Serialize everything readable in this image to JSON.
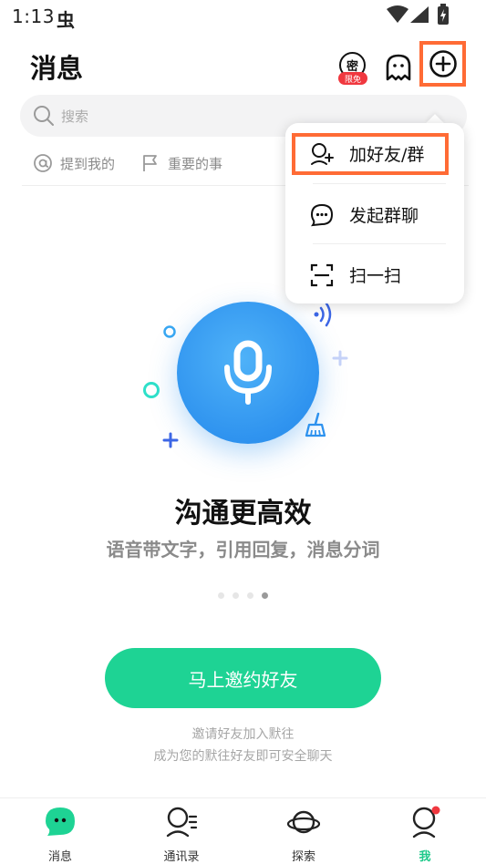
{
  "status_bar": {
    "time": "1:13",
    "app_icon": "虫"
  },
  "header": {
    "title": "消息",
    "secret_icon_text": "密",
    "secret_badge": "限免"
  },
  "search": {
    "placeholder": "搜索"
  },
  "filters": {
    "mention": "提到我的",
    "important": "重要的事"
  },
  "dropdown": {
    "items": [
      {
        "label": "加好友/群",
        "icon": "add-person-icon"
      },
      {
        "label": "发起群聊",
        "icon": "chat-bubble-icon"
      },
      {
        "label": "扫一扫",
        "icon": "scan-icon"
      }
    ]
  },
  "empty_state": {
    "title": "沟通更高效",
    "subtitle": "语音带文字，引用回复，消息分词",
    "page_count": 4,
    "active_page": 4
  },
  "invite": {
    "button_label": "马上邀约好友",
    "note_line1": "邀请好友加入默往",
    "note_line2": "成为您的默往好友即可安全聊天"
  },
  "bottom_nav": {
    "items": [
      {
        "label": "消息",
        "icon": "chat-bubble-icon"
      },
      {
        "label": "通讯录",
        "icon": "contacts-icon"
      },
      {
        "label": "探索",
        "icon": "planet-icon"
      },
      {
        "label": "我",
        "icon": "person-icon",
        "active": true
      }
    ]
  },
  "colors": {
    "accent_green": "#1ed394",
    "highlight_orange": "#ff6b35",
    "mic_blue": "#2f93ef",
    "badge_red": "#f0383f"
  }
}
